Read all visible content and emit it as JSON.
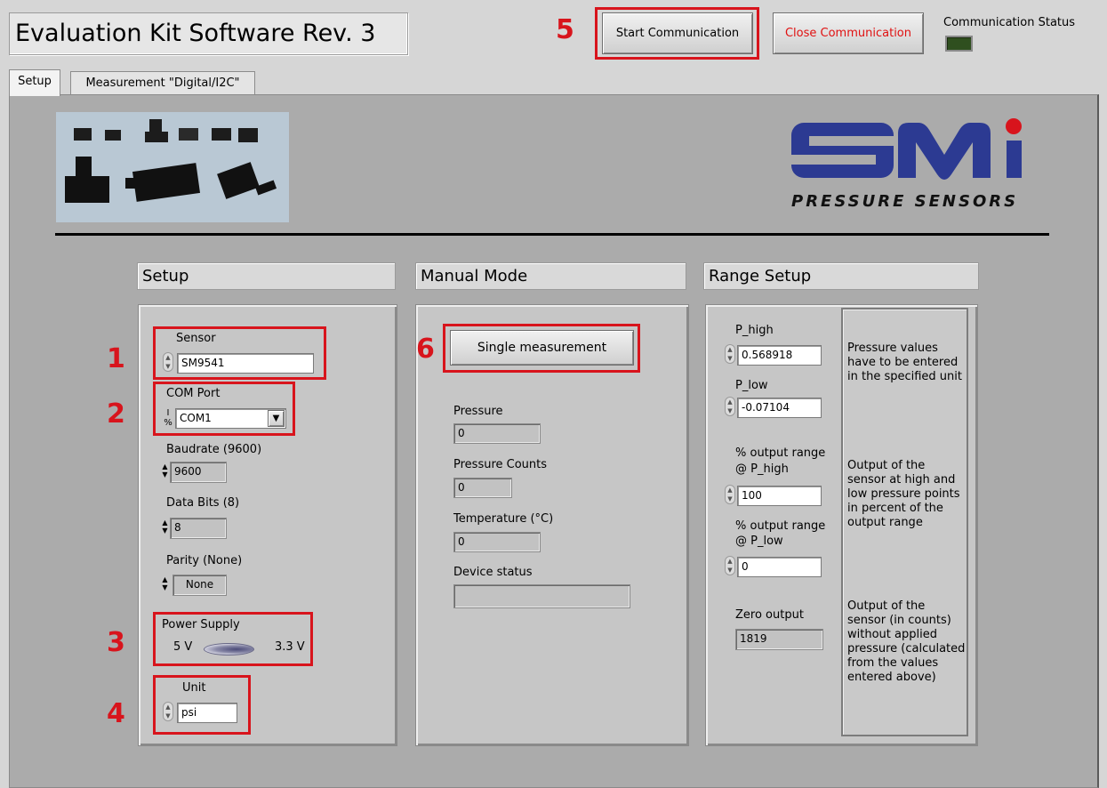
{
  "app": {
    "title": "Evaluation Kit Software Rev. 3",
    "start_button": "Start Communication",
    "close_button": "Close Communication",
    "comm_status_label": "Communication Status"
  },
  "tabs": [
    {
      "label": "Setup",
      "active": true
    },
    {
      "label": "Measurement \"Digital/I2C\"",
      "active": false
    }
  ],
  "logo": {
    "letters": "SMi",
    "tagline": "PRESSURE SENSORS"
  },
  "annotations": [
    "1",
    "2",
    "3",
    "4",
    "5",
    "6"
  ],
  "setup": {
    "header": "Setup",
    "sensor": {
      "label": "Sensor",
      "value": "SM9541"
    },
    "com_port": {
      "label": "COM Port",
      "value": "COM1"
    },
    "baudrate": {
      "label": "Baudrate (9600)",
      "value": "9600"
    },
    "data_bits": {
      "label": "Data Bits (8)",
      "value": "8"
    },
    "parity": {
      "label": "Parity (None)",
      "value": "None"
    },
    "power_supply": {
      "label": "Power Supply",
      "left": "5 V",
      "right": "3.3 V"
    },
    "unit": {
      "label": "Unit",
      "value": "psi"
    }
  },
  "manual": {
    "header": "Manual Mode",
    "single_button": "Single measurement",
    "pressure": {
      "label": "Pressure",
      "value": "0"
    },
    "pressure_counts": {
      "label": "Pressure Counts",
      "value": "0"
    },
    "temperature": {
      "label": "Temperature (°C)",
      "value": "0"
    },
    "device_status": {
      "label": "Device status",
      "value": ""
    }
  },
  "range": {
    "header": "Range Setup",
    "p_high": {
      "label": "P_high",
      "value": "0.568918"
    },
    "p_low": {
      "label": "P_low",
      "value": "-0.07104"
    },
    "out_high": {
      "label1": "% output range",
      "label2": "@ P_high",
      "value": "100"
    },
    "out_low": {
      "label1": "% output range",
      "label2": "@ P_low",
      "value": "0"
    },
    "zero_output": {
      "label": "Zero output",
      "value": "1819"
    },
    "info": [
      "Pressure values have to be entered in the specified unit",
      "Output of the sensor at high and low pressure points in percent of the output range",
      "Output of the sensor (in counts) without applied pressure (calculated from the values entered above)"
    ]
  },
  "colors": {
    "annotation": "#d8141c",
    "logo": "#2c3a92",
    "logo_dot": "#d8141c",
    "led": "#2f4f1f"
  }
}
